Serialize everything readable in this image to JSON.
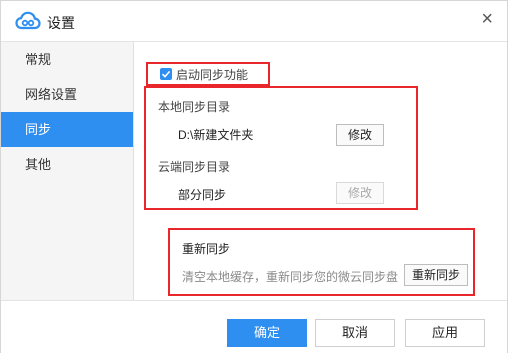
{
  "window": {
    "title": "设置"
  },
  "sidebar": {
    "items": [
      {
        "label": "常规"
      },
      {
        "label": "网络设置"
      },
      {
        "label": "同步"
      },
      {
        "label": "其他"
      }
    ]
  },
  "sync": {
    "enable_label": "启动同步功能",
    "enabled": true,
    "local_dir_title": "本地同步目录",
    "local_dir_path": "D:\\新建文件夹",
    "local_modify_button": "修改",
    "cloud_dir_title": "云端同步目录",
    "cloud_dir_value": "部分同步",
    "cloud_modify_button": "修改",
    "resync_title": "重新同步",
    "resync_description": "清空本地缓存，重新同步您的微云同步盘",
    "resync_button": "重新同步"
  },
  "footer": {
    "confirm": "确定",
    "cancel": "取消",
    "apply": "应用"
  },
  "colors": {
    "accent": "#2f8ff0",
    "highlight_border": "#e8262b"
  },
  "icons": {
    "app_logo": "cloud-icon",
    "close": "close-icon",
    "checkbox": "checkmark-icon"
  }
}
